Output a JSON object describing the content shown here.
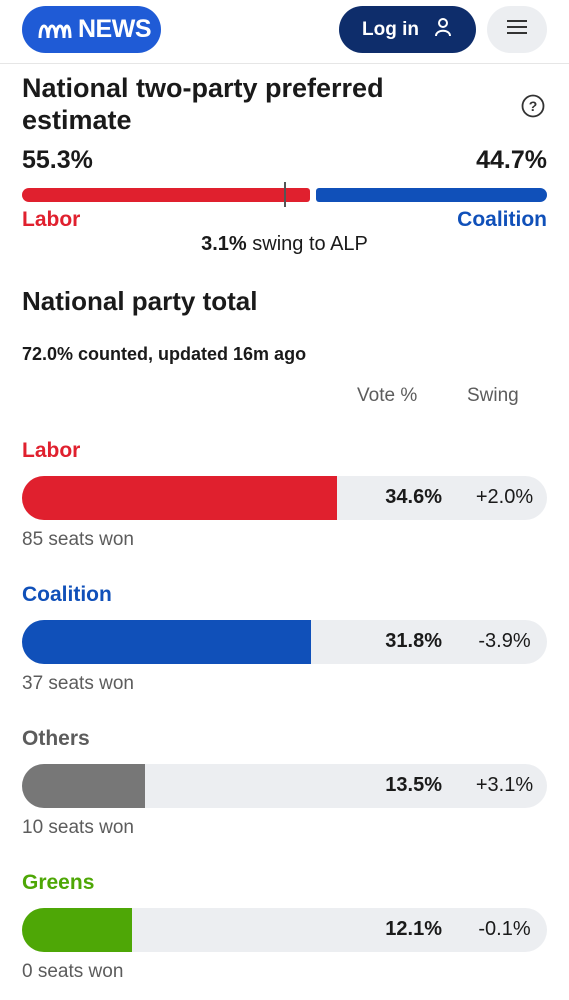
{
  "header": {
    "logo_text": "NEWS",
    "login_label": "Log in"
  },
  "tpp": {
    "title": "National two-party preferred estimate",
    "labor_pct": "55.3%",
    "coalition_pct": "44.7%",
    "labor_label": "Labor",
    "coalition_label": "Coalition",
    "swing_value": "3.1%",
    "swing_text": " swing to ALP",
    "labor_share": 0.553
  },
  "national": {
    "title": "National party total",
    "counted": "72.0% counted, updated 16m ago",
    "col_vote": "Vote %",
    "col_swing": "Swing",
    "parties": [
      {
        "name": "Labor",
        "vote": "34.6%",
        "swing": "+2.0%",
        "seats": "85 seats won",
        "color": "#e0202e",
        "fill": 0.6
      },
      {
        "name": "Coalition",
        "vote": "31.8%",
        "swing": "-3.9%",
        "seats": "37 seats won",
        "color": "#1050b9",
        "fill": 0.55
      },
      {
        "name": "Others",
        "vote": "13.5%",
        "swing": "+3.1%",
        "seats": "10 seats won",
        "color": "#777777",
        "fill": 0.234
      },
      {
        "name": "Greens",
        "vote": "12.1%",
        "swing": "-0.1%",
        "seats": "0 seats won",
        "color": "#4ea706",
        "fill": 0.21
      }
    ]
  }
}
